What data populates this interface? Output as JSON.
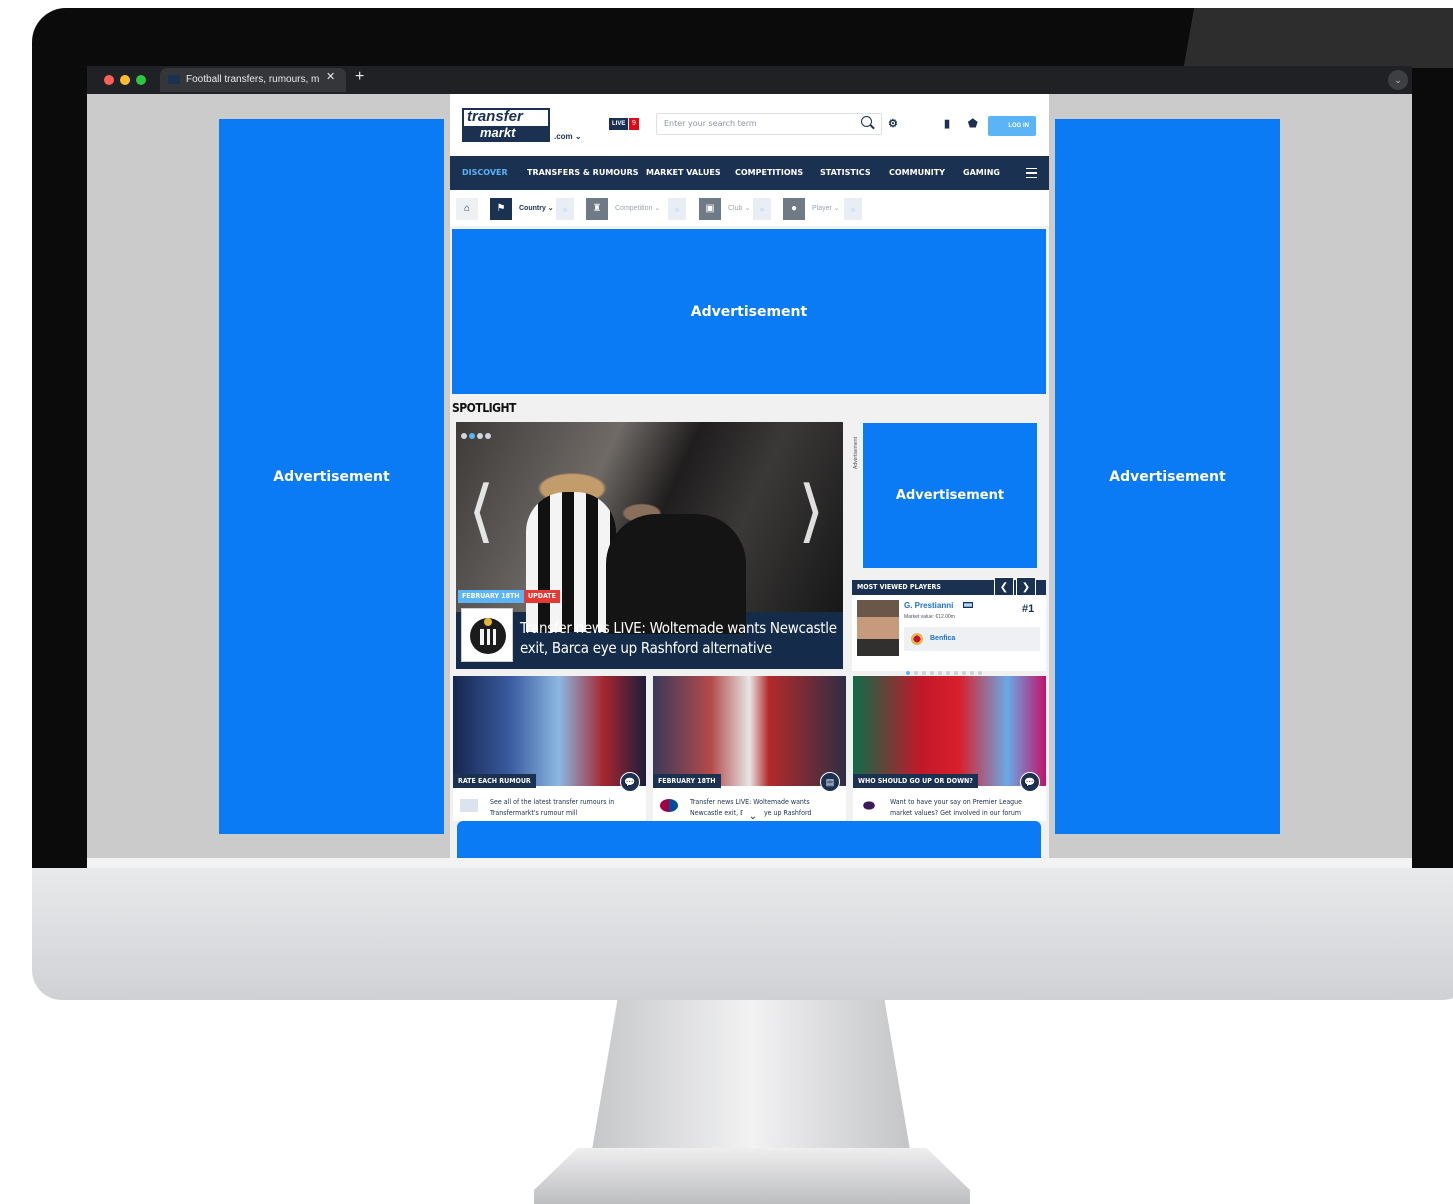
{
  "browser": {
    "tab_title": "Football transfers, rumours, m",
    "close_glyph": "✕",
    "new_tab_glyph": "+",
    "menu_glyph": "⌄"
  },
  "ads": {
    "label": "Advertisement",
    "side_label": "Advertisement",
    "vertical_label": "Advertisement"
  },
  "header": {
    "logo_line1": "transfer",
    "logo_line2": "markt",
    "logo_suffix": ".com ⌄",
    "live_label": "LIVE",
    "live_count": "9",
    "search_placeholder": "Enter your search term",
    "login_label": "LOG IN"
  },
  "nav": {
    "items": [
      "DISCOVER",
      "TRANSFERS & RUMOURS",
      "MARKET VALUES",
      "COMPETITIONS",
      "STATISTICS",
      "COMMUNITY",
      "GAMING"
    ]
  },
  "breadcrumb": {
    "country": "Country ⌄",
    "competition": "Competition ⌄",
    "club": "Club ⌄",
    "player": "Player ⌄",
    "arrow_glyph": "»"
  },
  "spotlight": {
    "title": "SPOTLIGHT",
    "date_tag": "FEBRUARY 18TH",
    "type_tag": "UPDATE",
    "headline": "Transfer news LIVE: Woltemade wants Newcastle exit, Barca eye up Rashford alternative",
    "prev_glyph": "⟨",
    "next_glyph": "⟩"
  },
  "most_viewed": {
    "title": "MOST VIEWED PLAYERS",
    "player_name": "G. Prestianni",
    "market_value": "Market value: €12.00m",
    "rank": "#1",
    "club": "Benfica",
    "prev_glyph": "❮",
    "next_glyph": "❯"
  },
  "cards": [
    {
      "label": "RATE EACH RUMOUR",
      "text": "See all of the latest transfer rumours in Transfermarkt's rumour mill"
    },
    {
      "label": "FEBRUARY 18TH",
      "text": "Transfer news LIVE: Woltemade wants Newcastle exit, Barca eye up Rashford"
    },
    {
      "label": "WHO SHOULD GO UP OR DOWN?",
      "text": "Want to have your say on Premier League market values? Get involved in our forum"
    }
  ],
  "colors": {
    "ad_blue": "#0a7af5",
    "navy": "#1a3152",
    "accent": "#5bb4f5",
    "update_red": "#e53935"
  }
}
